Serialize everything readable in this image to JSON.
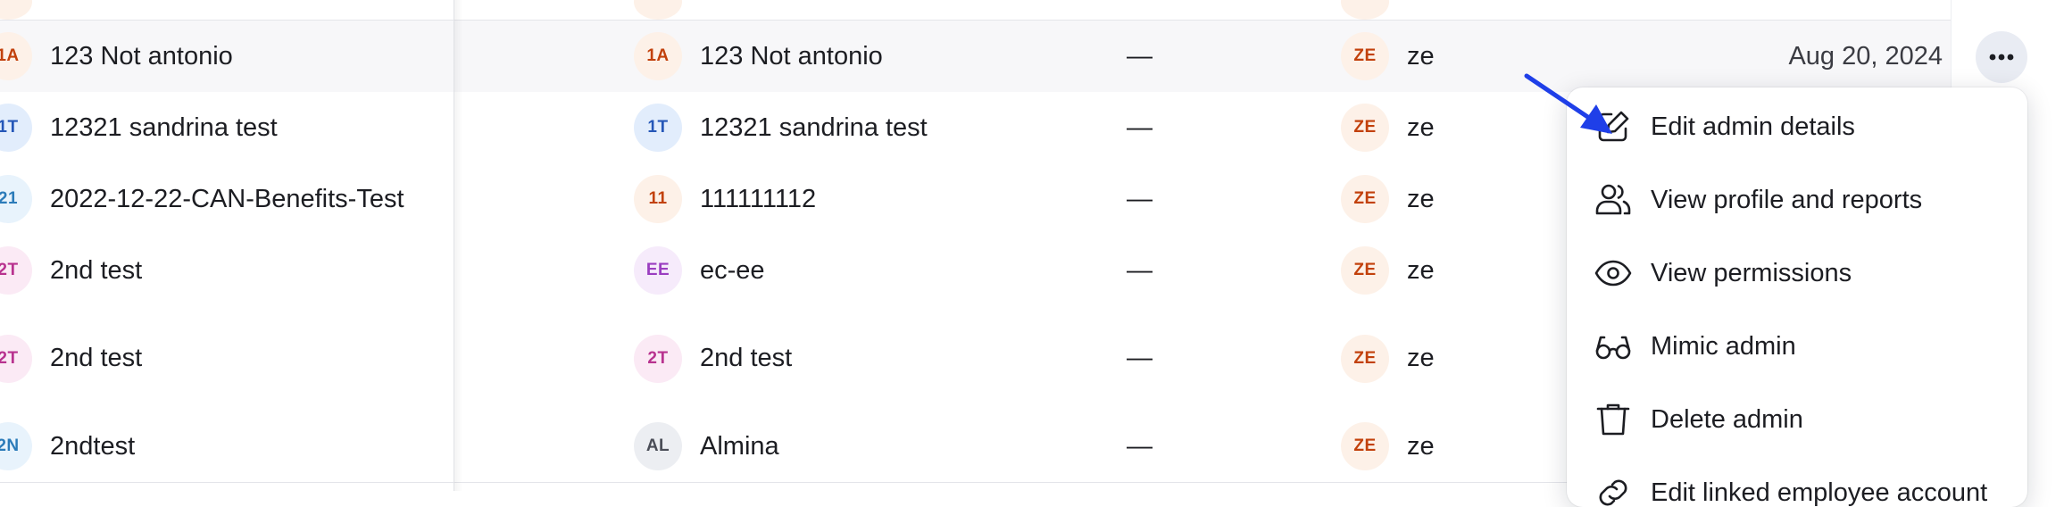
{
  "colors": {
    "accent_arrow": "#1f3fe8",
    "row_highlight": "#f7f7f9",
    "divider": "#e4e5ea"
  },
  "rows": [
    {
      "name": "123 Not antonio",
      "name_initials": "1A",
      "name_badge": {
        "bg": "#fdf1e8",
        "fg": "#c2410c"
      },
      "legal": "123 Not antonio",
      "legal_initials": "1A",
      "legal_badge": {
        "bg": "#fdf1e8",
        "fg": "#c2410c"
      },
      "dash": "—",
      "admin_initials": "ZE",
      "admin": "ze",
      "date": "Aug 20, 2024"
    },
    {
      "name": "12321 sandrina test",
      "name_initials": "1T",
      "name_badge": {
        "bg": "#e2edfc",
        "fg": "#2557b8"
      },
      "legal": "12321 sandrina test",
      "legal_initials": "1T",
      "legal_badge": {
        "bg": "#e2edfc",
        "fg": "#2557b8"
      },
      "dash": "—",
      "admin_initials": "ZE",
      "admin": "ze",
      "date": ""
    },
    {
      "name": "2022-12-22-CAN-Benefits-Test",
      "name_initials": "21",
      "name_badge": {
        "bg": "#e8f3fc",
        "fg": "#2b7bb9"
      },
      "legal": "111111112",
      "legal_initials": "11",
      "legal_badge": {
        "bg": "#fdf1e8",
        "fg": "#c2410c"
      },
      "dash": "—",
      "admin_initials": "ZE",
      "admin": "ze",
      "date": ""
    },
    {
      "name": "2nd test",
      "name_initials": "2T",
      "name_badge": {
        "bg": "#fbeaf5",
        "fg": "#b8328f"
      },
      "legal": "ec-ee",
      "legal_initials": "EE",
      "legal_badge": {
        "bg": "#f6ebfb",
        "fg": "#9a3dc0"
      },
      "dash": "—",
      "admin_initials": "ZE",
      "admin": "ze",
      "date": ""
    },
    {
      "name": "2nd test",
      "name_initials": "2T",
      "name_badge": {
        "bg": "#fbeaf5",
        "fg": "#b8328f"
      },
      "legal": "2nd test",
      "legal_initials": "2T",
      "legal_badge": {
        "bg": "#fbeaf5",
        "fg": "#b8328f"
      },
      "dash": "—",
      "admin_initials": "ZE",
      "admin": "ze",
      "date": ""
    },
    {
      "name": "2ndtest",
      "name_initials": "2N",
      "name_badge": {
        "bg": "#e8f3fc",
        "fg": "#2b7bb9"
      },
      "legal": "Almina",
      "legal_initials": "AL",
      "legal_badge": {
        "bg": "#eceef2",
        "fg": "#4a4d57"
      },
      "dash": "—",
      "admin_initials": "ZE",
      "admin": "ze",
      "date": ""
    }
  ],
  "admin_badge": {
    "bg": "#fdf1e8",
    "fg": "#c2410c"
  },
  "more_button": {
    "icon": "more-horizontal-icon"
  },
  "menu": {
    "items": [
      {
        "label": "Edit admin details",
        "icon": "edit-icon"
      },
      {
        "label": "View profile and reports",
        "icon": "users-icon"
      },
      {
        "label": "View permissions",
        "icon": "eye-icon"
      },
      {
        "label": "Mimic admin",
        "icon": "glasses-icon"
      },
      {
        "label": "Delete admin",
        "icon": "trash-icon"
      },
      {
        "label": "Edit linked employee account",
        "icon": "link-icon"
      }
    ]
  }
}
